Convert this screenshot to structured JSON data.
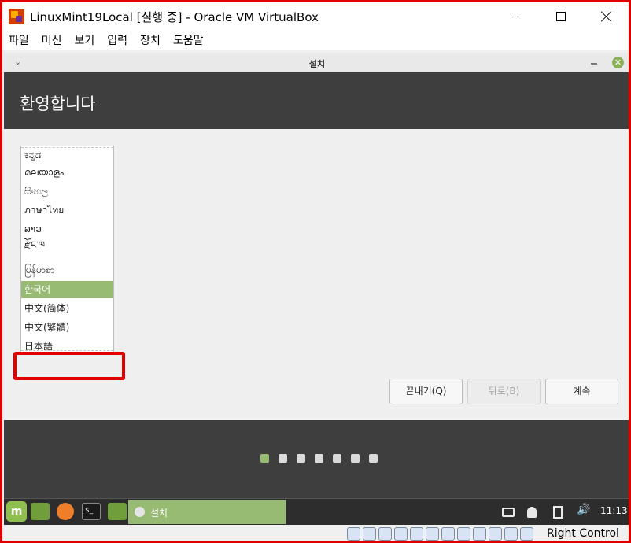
{
  "window": {
    "title": "LinuxMint19Local [실행 중] - Oracle VM VirtualBox"
  },
  "menubar": {
    "items": [
      {
        "label": "파일"
      },
      {
        "label": "머신"
      },
      {
        "label": "보기"
      },
      {
        "label": "입력"
      },
      {
        "label": "장치"
      },
      {
        "label": "도움말"
      }
    ]
  },
  "installer": {
    "window_title": "설치",
    "menu_icon": "⌄",
    "close_icon": "✕",
    "header_title": "환영합니다",
    "languages": [
      {
        "label": "ಕನ್ನಡ",
        "selected": false
      },
      {
        "label": "മലയാളം",
        "selected": false
      },
      {
        "label": "සිංහල",
        "selected": false
      },
      {
        "label": "ภาษาไทย",
        "selected": false
      },
      {
        "label": "ລາວ",
        "selected": false
      },
      {
        "label": "རྫོང་ཁ",
        "selected": false
      },
      {
        "label": "မြန်မာစာ",
        "selected": false
      },
      {
        "label": "한국어",
        "selected": true
      },
      {
        "label": "中文(简体)",
        "selected": false
      },
      {
        "label": "中文(繁體)",
        "selected": false
      },
      {
        "label": "日本語",
        "selected": false
      }
    ],
    "buttons": {
      "quit": "끝내기(Q)",
      "back": "뒤로(B)",
      "continue": "계속"
    },
    "progress": {
      "total_steps": 7,
      "current_step": 1
    }
  },
  "taskbar": {
    "mint_menu_icon": "m",
    "terminal_glyph": "$_",
    "task_label": "설치",
    "volume_icon": "🔊",
    "clock": "11:13"
  },
  "statusbar": {
    "host_key": "Right Control",
    "icon_count": 14
  },
  "colors": {
    "accent": "#97bb72",
    "dark_bg": "#3e3e3e",
    "highlight_red": "#e00000"
  }
}
